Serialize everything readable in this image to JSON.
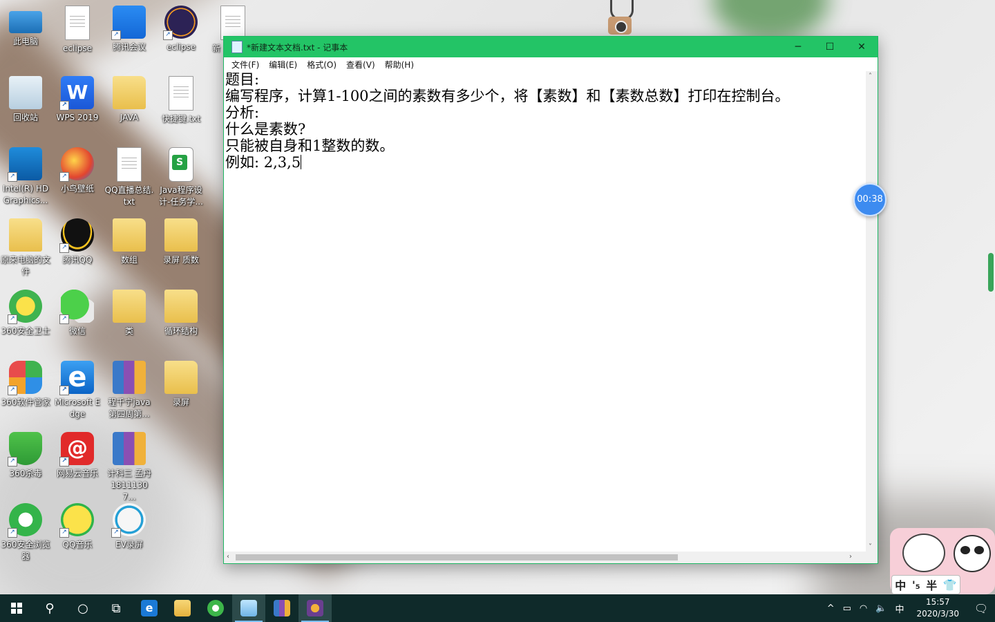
{
  "desktop": {
    "icons": [
      {
        "label": "此电脑",
        "icon": "computer-icon"
      },
      {
        "label": "eclipse",
        "icon": "eclipse-icon"
      },
      {
        "label": "腾讯会议",
        "icon": "tencent-meeting-icon"
      },
      {
        "label": "eclipse",
        "icon": "eclipse-icon"
      },
      {
        "label": "新",
        "icon": "text-file-icon"
      },
      {
        "label": "回收站",
        "icon": "recycle-bin-icon"
      },
      {
        "label": "WPS 2019",
        "icon": "wps-icon"
      },
      {
        "label": "JAVA",
        "icon": "folder-icon"
      },
      {
        "label": "快捷键.txt",
        "icon": "text-file-icon"
      },
      {
        "label": "Intel(R) HD Graphics...",
        "icon": "intel-graphics-icon"
      },
      {
        "label": "小鸟壁纸",
        "icon": "bird-wallpaper-icon"
      },
      {
        "label": "QQ直播总结.txt",
        "icon": "text-file-icon"
      },
      {
        "label": "Java程序设计-任务学...",
        "icon": "spreadsheet-file-icon"
      },
      {
        "label": "原来电脑的文件",
        "icon": "folder-icon"
      },
      {
        "label": "腾讯QQ",
        "icon": "qq-icon"
      },
      {
        "label": "数组",
        "icon": "folder-icon"
      },
      {
        "label": "录屏 质数",
        "icon": "folder-icon"
      },
      {
        "label": "360安全卫士",
        "icon": "360-security-icon"
      },
      {
        "label": "微信",
        "icon": "wechat-icon"
      },
      {
        "label": "类",
        "icon": "folder-icon"
      },
      {
        "label": "循环结构",
        "icon": "folder-icon"
      },
      {
        "label": "360软件管家",
        "icon": "360-software-icon"
      },
      {
        "label": "Microsoft Edge",
        "icon": "edge-icon"
      },
      {
        "label": "程千宁java第四周第...",
        "icon": "archive-icon"
      },
      {
        "label": "录屏",
        "icon": "folder-icon"
      },
      {
        "label": "360杀毒",
        "icon": "360-antivirus-icon"
      },
      {
        "label": "网易云音乐",
        "icon": "netease-music-icon"
      },
      {
        "label": "计科三 孟丹 18111307...",
        "icon": "archive-icon"
      },
      {
        "label": "360安全浏览器",
        "icon": "360-browser-icon"
      },
      {
        "label": "QQ音乐",
        "icon": "qq-music-icon"
      },
      {
        "label": "EV录屏",
        "icon": "ev-recorder-icon"
      }
    ]
  },
  "notepad": {
    "title": "*新建文本文档.txt - 记事本",
    "controls": {
      "minimize": "─",
      "maximize": "☐",
      "close": "✕"
    },
    "menu": [
      "文件(F)",
      "编辑(E)",
      "格式(O)",
      "查看(V)",
      "帮助(H)"
    ],
    "lines": [
      "题目:",
      "编写程序，计算1-100之间的素数有多少个，将【素数】和【素数总数】打印在控制台。",
      "分析:",
      "什么是素数?",
      "只能被自身和1整数的数。",
      "例如: 2,3,5"
    ]
  },
  "overlay": {
    "timer": "00:38",
    "ime": [
      "中",
      "'₅",
      "半",
      "👕"
    ]
  },
  "taskbar": {
    "apps": [
      "start",
      "search",
      "cortana",
      "task-view",
      "edge",
      "file-explorer",
      "360-browser",
      "notepad",
      "winrar",
      "ev-recorder"
    ],
    "tray": {
      "chevron": "^",
      "input_method": "中",
      "time": "15:57",
      "date": "2020/3/30"
    }
  }
}
